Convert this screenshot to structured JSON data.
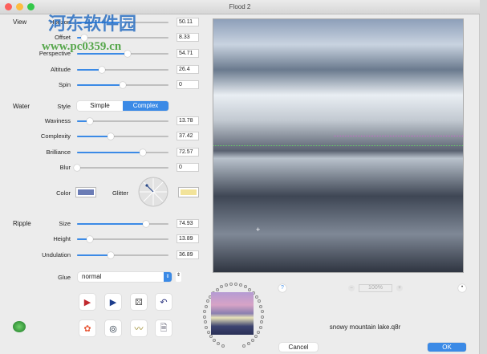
{
  "window": {
    "title": "Flood 2"
  },
  "watermark": {
    "text": "河东软件园",
    "url": "www.pc0359.cn"
  },
  "view": {
    "section": "View",
    "rows": [
      {
        "label": "Horizon",
        "value": "50.11",
        "level": 0.5
      },
      {
        "label": "Offset",
        "value": "8.33",
        "level": 0.08
      },
      {
        "label": "Perspective",
        "value": "54.71",
        "level": 0.55
      },
      {
        "label": "Altitude",
        "value": "26.4",
        "level": 0.27
      },
      {
        "label": "Spin",
        "value": "0",
        "level": 0.5
      }
    ]
  },
  "water": {
    "section": "Water",
    "style_label": "Style",
    "style_options": [
      "Simple",
      "Complex"
    ],
    "style_selected": "Complex",
    "rows": [
      {
        "label": "Waviness",
        "value": "13.78",
        "level": 0.14
      },
      {
        "label": "Complexity",
        "value": "37.42",
        "level": 0.37
      },
      {
        "label": "Brilliance",
        "value": "72.57",
        "level": 0.72
      },
      {
        "label": "Blur",
        "value": "0",
        "level": 0
      }
    ],
    "color_label": "Color",
    "color": "#6b7cb5",
    "glitter_label": "Glitter",
    "glitter_color": "#f2e39a"
  },
  "ripple": {
    "section": "Ripple",
    "rows": [
      {
        "label": "Size",
        "value": "74.93",
        "level": 0.75
      },
      {
        "label": "Height",
        "value": "13.89",
        "level": 0.14
      },
      {
        "label": "Undulation",
        "value": "36.89",
        "level": 0.37
      }
    ]
  },
  "glue": {
    "label": "Glue",
    "value": "normal"
  },
  "zoom": {
    "value": "100%",
    "minus": "−",
    "plus": "+"
  },
  "help": "?",
  "filename": "snowy mountain lake.q8r",
  "buttons": {
    "cancel": "Cancel",
    "ok": "OK"
  },
  "colors": {
    "accent": "#3b8ae6"
  }
}
